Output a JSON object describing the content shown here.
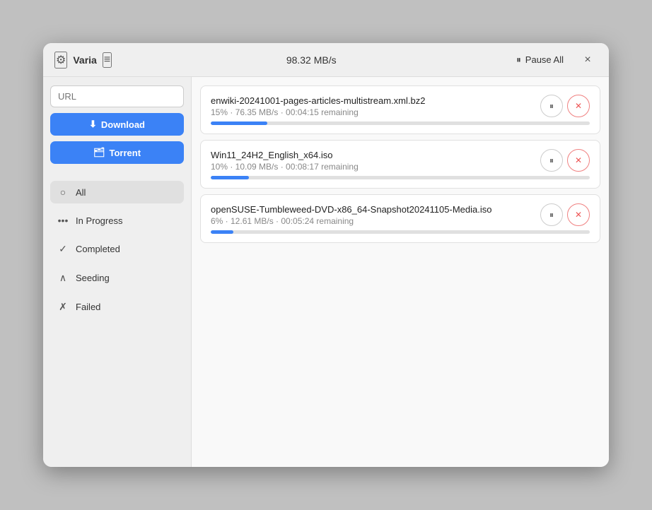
{
  "titlebar": {
    "app_name": "Varia",
    "speed": "98.32 MB/s",
    "pause_all_label": "Pause All",
    "close_label": "×"
  },
  "sidebar": {
    "url_placeholder": "URL",
    "download_btn_label": "Download",
    "torrent_btn_label": "Torrent",
    "nav_items": [
      {
        "id": "all",
        "icon": "●",
        "label": "All",
        "active": true
      },
      {
        "id": "in-progress",
        "icon": "•••",
        "label": "In Progress",
        "active": false
      },
      {
        "id": "completed",
        "icon": "✓",
        "label": "Completed",
        "active": false
      },
      {
        "id": "seeding",
        "icon": "∧",
        "label": "Seeding",
        "active": false
      },
      {
        "id": "failed",
        "icon": "✗",
        "label": "Failed",
        "active": false
      }
    ]
  },
  "downloads": [
    {
      "id": "dl1",
      "filename": "enwiki-20241001-pages-articles-multistream.xml.bz2",
      "percent": 15,
      "speed": "76.35 MB/s",
      "remaining": "00:04:15 remaining",
      "meta": "15%  ·  76.35 MB/s  ·  00:04:15 remaining"
    },
    {
      "id": "dl2",
      "filename": "Win11_24H2_English_x64.iso",
      "percent": 10,
      "speed": "10.09 MB/s",
      "remaining": "00:08:17 remaining",
      "meta": "10%  ·  10.09 MB/s  ·  00:08:17 remaining"
    },
    {
      "id": "dl3",
      "filename": "openSUSE-Tumbleweed-DVD-x86_64-Snapshot20241105-Media.iso",
      "percent": 6,
      "speed": "12.61 MB/s",
      "remaining": "00:05:24 remaining",
      "meta": "6%  ·  12.61 MB/s  ·  00:05:24 remaining"
    }
  ],
  "icons": {
    "gear": "⚙",
    "menu": "≡",
    "pause_bars": "⏸",
    "pause_item": "⏸",
    "remove": "✕",
    "download_arrow": "⬇",
    "torrent_icon": "🗂"
  }
}
